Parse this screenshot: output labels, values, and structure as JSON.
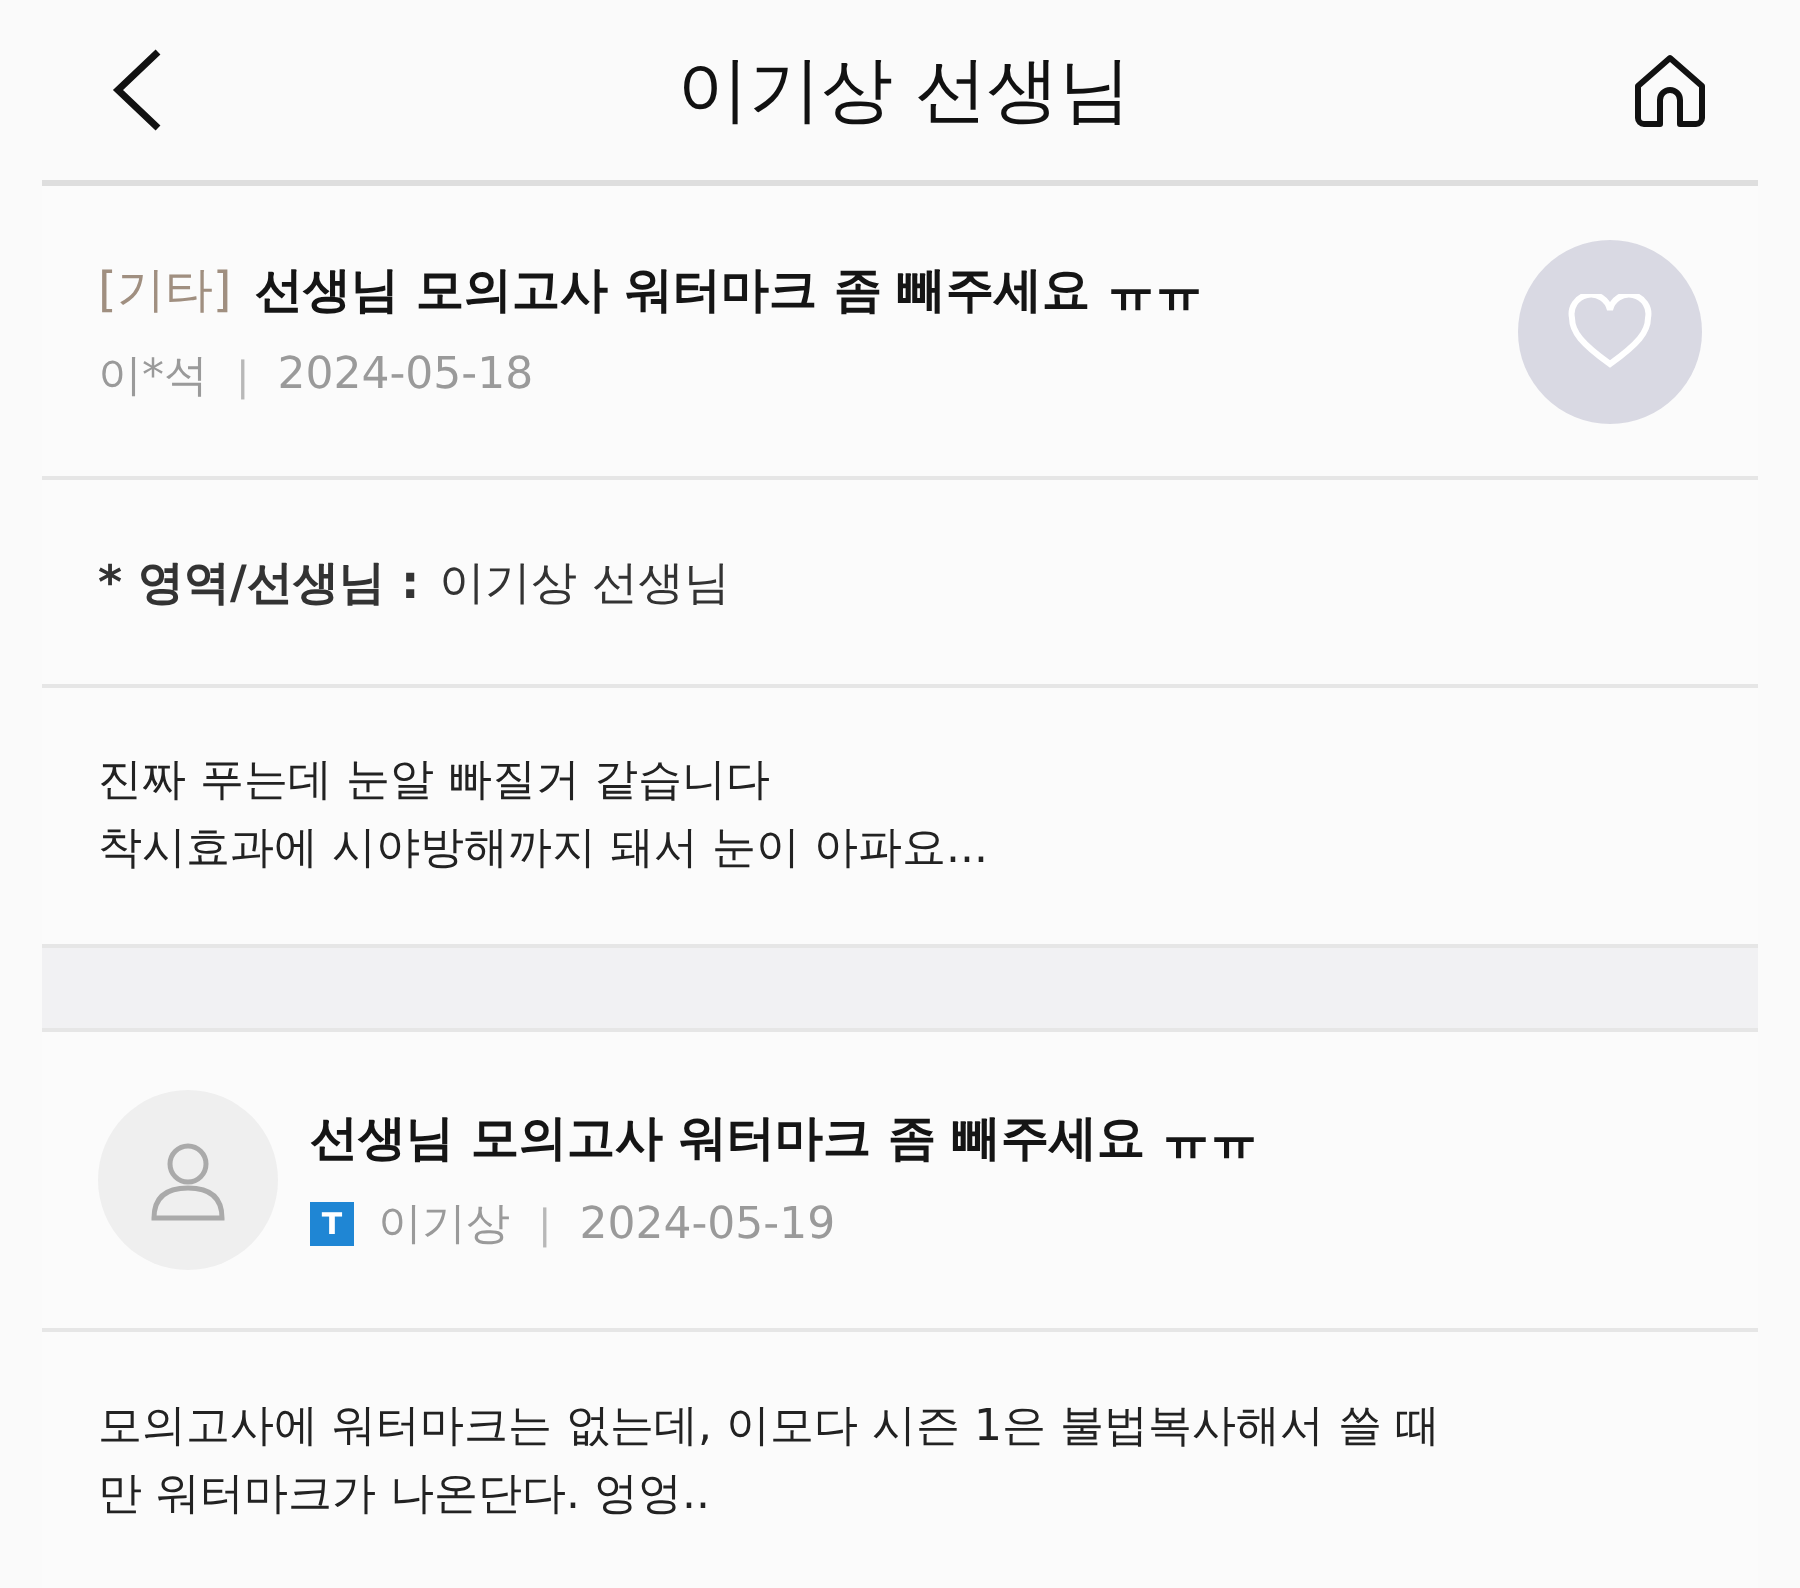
{
  "header": {
    "title": "이기상 선생님"
  },
  "question": {
    "category": "[기타]",
    "title": "선생님 모의고사 워터마크 좀 빼주세요 ㅠㅠ",
    "author": "이*석",
    "separator": "|",
    "date": "2024-05-18"
  },
  "field": {
    "label": "* 영역/선생님 :",
    "value": "이기상 선생님"
  },
  "question_body": "진짜 푸는데 눈알 빠질거 같습니다\n착시효과에 시야방해까지 돼서 눈이 아파요...",
  "answer": {
    "title": "선생님 모의고사 워터마크 좀 빼주세요 ㅠㅠ",
    "badge": "T",
    "author": "이기상",
    "separator": "|",
    "date": "2024-05-19"
  },
  "answer_body": "모의고사에 워터마크는 없는데, 이모다 시즌 1은 불법복사해서 쓸 때\n만 워터마크가 나온단다. 엉엉.."
}
